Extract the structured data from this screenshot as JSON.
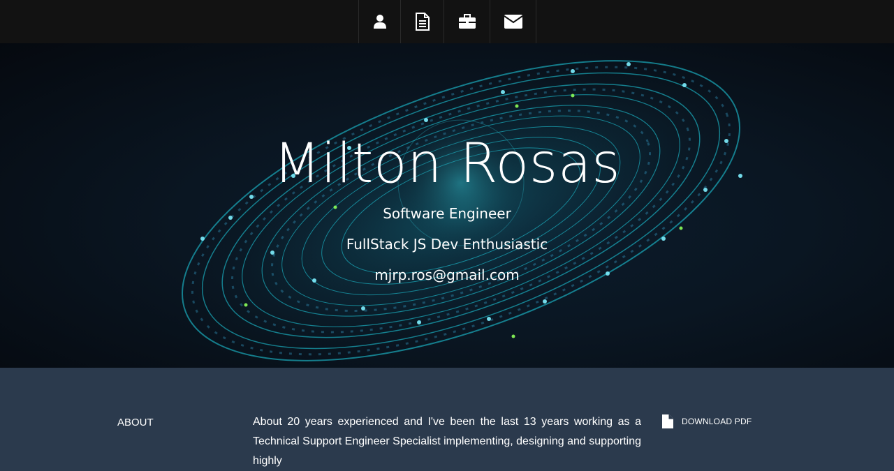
{
  "nav": {
    "items": [
      {
        "icon": "user-icon"
      },
      {
        "icon": "document-icon"
      },
      {
        "icon": "briefcase-icon"
      },
      {
        "icon": "envelope-icon"
      }
    ]
  },
  "hero": {
    "name": "Milton Rosas",
    "role": "Software Engineer",
    "tagline": "FullStack JS Dev Enthusiastic",
    "email": "mjrp.ros@gmail.com"
  },
  "about": {
    "label": "ABOUT",
    "text": "About 20 years experienced and I've been the last 13 years working as a Technical Support Engineer Specialist implementing, designing and supporting highly",
    "download_label": "DOWNLOAD PDF"
  },
  "colors": {
    "nav_bg": "#121212",
    "hero_bg": "#0a1622",
    "galaxy_accent": "#1fd6e8",
    "about_bg": "#2b3a4d",
    "text": "#ffffff"
  }
}
